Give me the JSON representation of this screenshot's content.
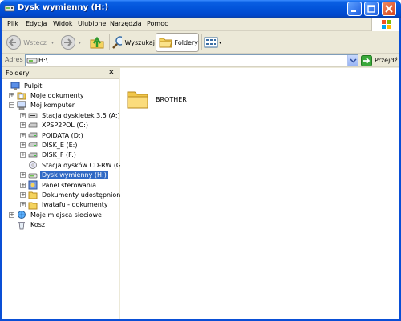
{
  "window": {
    "title": "Dysk wymienny (H:)"
  },
  "menubar": {
    "items": [
      "Plik",
      "Edycja",
      "Widok",
      "Ulubione",
      "Narzędzia",
      "Pomoc"
    ]
  },
  "toolbar": {
    "back_label": "Wstecz",
    "search_label": "Wyszukaj",
    "folders_label": "Foldery"
  },
  "addressbar": {
    "label": "Adres",
    "value": "H:\\",
    "go_label": "Przejdź"
  },
  "folders_pane": {
    "title": "Foldery",
    "close_glyph": "×",
    "tree": [
      {
        "label": "Pulpit",
        "icon": "desktop-icon",
        "level": 0,
        "expander": ""
      },
      {
        "label": "Moje dokumenty",
        "icon": "my-documents-icon",
        "level": 1,
        "expander": "+"
      },
      {
        "label": "Mój komputer",
        "icon": "my-computer-icon",
        "level": 1,
        "expander": "−"
      },
      {
        "label": "Stacja dyskietek 3,5 (A:)",
        "icon": "floppy-drive-icon",
        "level": 2,
        "expander": "+"
      },
      {
        "label": "XPSP2POL (C:)",
        "icon": "hard-drive-icon",
        "level": 2,
        "expander": "+"
      },
      {
        "label": "PQIDATA (D:)",
        "icon": "hard-drive-icon",
        "level": 2,
        "expander": "+"
      },
      {
        "label": "DISK_E (E:)",
        "icon": "hard-drive-icon",
        "level": 2,
        "expander": "+"
      },
      {
        "label": "DISK_F (F:)",
        "icon": "hard-drive-icon",
        "level": 2,
        "expander": "+"
      },
      {
        "label": "Stacja dysków CD-RW (G:)",
        "icon": "cd-drive-icon",
        "level": 2,
        "expander": ""
      },
      {
        "label": "Dysk wymienny (H:)",
        "icon": "removable-drive-icon",
        "level": 2,
        "expander": "+",
        "selected": true
      },
      {
        "label": "Panel sterowania",
        "icon": "control-panel-icon",
        "level": 2,
        "expander": "+"
      },
      {
        "label": "Dokumenty udostępnione",
        "icon": "folder-icon",
        "level": 2,
        "expander": "+"
      },
      {
        "label": "iwatafu - dokumenty",
        "icon": "folder-icon",
        "level": 2,
        "expander": "+"
      },
      {
        "label": "Moje miejsca sieciowe",
        "icon": "network-places-icon",
        "level": 1,
        "expander": "+"
      },
      {
        "label": "Kosz",
        "icon": "recycle-bin-icon",
        "level": 1,
        "expander": ""
      }
    ]
  },
  "content": {
    "items": [
      {
        "name": "BROTHER",
        "icon": "folder-icon"
      }
    ]
  },
  "colors": {
    "titlebar": "#0253d9",
    "selection": "#316ac5",
    "chrome": "#ece9d8"
  }
}
